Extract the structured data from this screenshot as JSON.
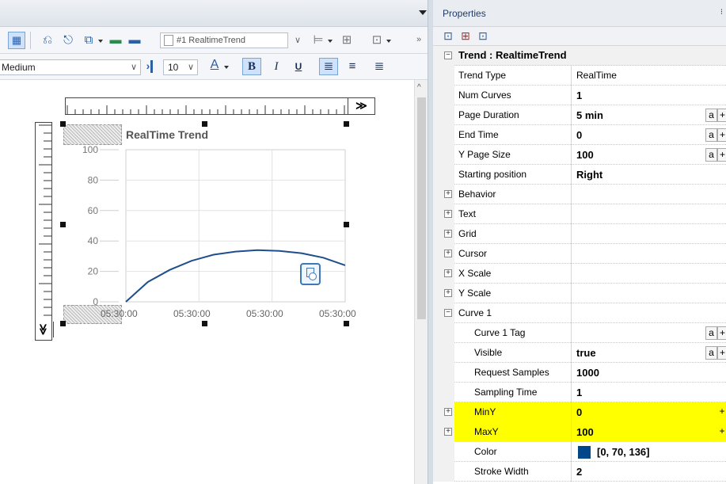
{
  "editor": {
    "toolbar": {
      "object_selector": "#1 RealtimeTrend",
      "font_weight": "Medium",
      "font_size": "10",
      "overflow": "»",
      "bold": "B",
      "italic": "I",
      "underline": "U"
    },
    "ruler": {
      "next_label": "≫",
      "down_label": "≫"
    },
    "chart_data": {
      "type": "line",
      "title": "RealTime Trend",
      "xlabel": "",
      "ylabel": "",
      "ylim": [
        0,
        100
      ],
      "yticks": [
        "100",
        "80",
        "60",
        "40",
        "20",
        "0"
      ],
      "xticks": [
        "05:30:00",
        "05:30:00",
        "05:30:00",
        "05:30:00"
      ],
      "grid": true,
      "series": [
        {
          "color": "#1f4e8c",
          "x": [
            0,
            0.1,
            0.2,
            0.3,
            0.4,
            0.5,
            0.6,
            0.7,
            0.8,
            0.9,
            1.0
          ],
          "values": [
            0,
            13,
            21,
            27,
            31,
            33,
            34,
            33.5,
            32,
            29,
            24
          ]
        }
      ]
    }
  },
  "properties": {
    "title": "Properties",
    "rows": [
      {
        "kind": "category",
        "expander": "−",
        "name": "Trend : RealtimeTrend",
        "bold": true
      },
      {
        "kind": "prop",
        "name": "Trend Type",
        "value": "RealTime",
        "value_style": "normal"
      },
      {
        "kind": "prop",
        "name": "Num Curves",
        "value": "1",
        "value_style": "bold"
      },
      {
        "kind": "prop",
        "name": "Page Duration",
        "value": "5 min",
        "value_style": "bold",
        "btn": true
      },
      {
        "kind": "prop",
        "name": "End Time",
        "value": "0",
        "value_style": "bold",
        "btn": true
      },
      {
        "kind": "prop",
        "name": "Y Page Size",
        "value": "100",
        "value_style": "bold",
        "btn": true
      },
      {
        "kind": "prop",
        "name": "Starting position",
        "value": "Right",
        "value_style": "bold"
      },
      {
        "kind": "group",
        "expander": "+",
        "name": "Behavior"
      },
      {
        "kind": "group",
        "expander": "+",
        "name": "Text"
      },
      {
        "kind": "group",
        "expander": "+",
        "name": "Grid"
      },
      {
        "kind": "group",
        "expander": "+",
        "name": "Cursor"
      },
      {
        "kind": "group",
        "expander": "+",
        "name": "X Scale"
      },
      {
        "kind": "group",
        "expander": "+",
        "name": "Y Scale"
      },
      {
        "kind": "group",
        "expander": "−",
        "name": "Curve 1"
      },
      {
        "kind": "sub",
        "name": "Curve 1 Tag",
        "value": "",
        "btn": true
      },
      {
        "kind": "sub",
        "name": "Visible",
        "value": "true",
        "value_style": "bold",
        "btn": true
      },
      {
        "kind": "sub",
        "name": "Request Samples",
        "value": "1000",
        "value_style": "bold"
      },
      {
        "kind": "sub",
        "name": "Sampling Time",
        "value": "1",
        "value_style": "bold"
      },
      {
        "kind": "subgroup",
        "expander": "+",
        "name": "MinY",
        "value": "0",
        "value_style": "bold",
        "highlight": true,
        "plus": true
      },
      {
        "kind": "subgroup",
        "expander": "+",
        "name": "MaxY",
        "value": "100",
        "value_style": "bold",
        "highlight": true,
        "plus": true
      },
      {
        "kind": "sub",
        "name": "Color",
        "value": "[0, 70, 136]",
        "value_style": "bold",
        "swatch": "#004688"
      },
      {
        "kind": "sub",
        "name": "Stroke Width",
        "value": "2",
        "value_style": "bold"
      }
    ],
    "button_a": "a",
    "button_plus": "+"
  }
}
